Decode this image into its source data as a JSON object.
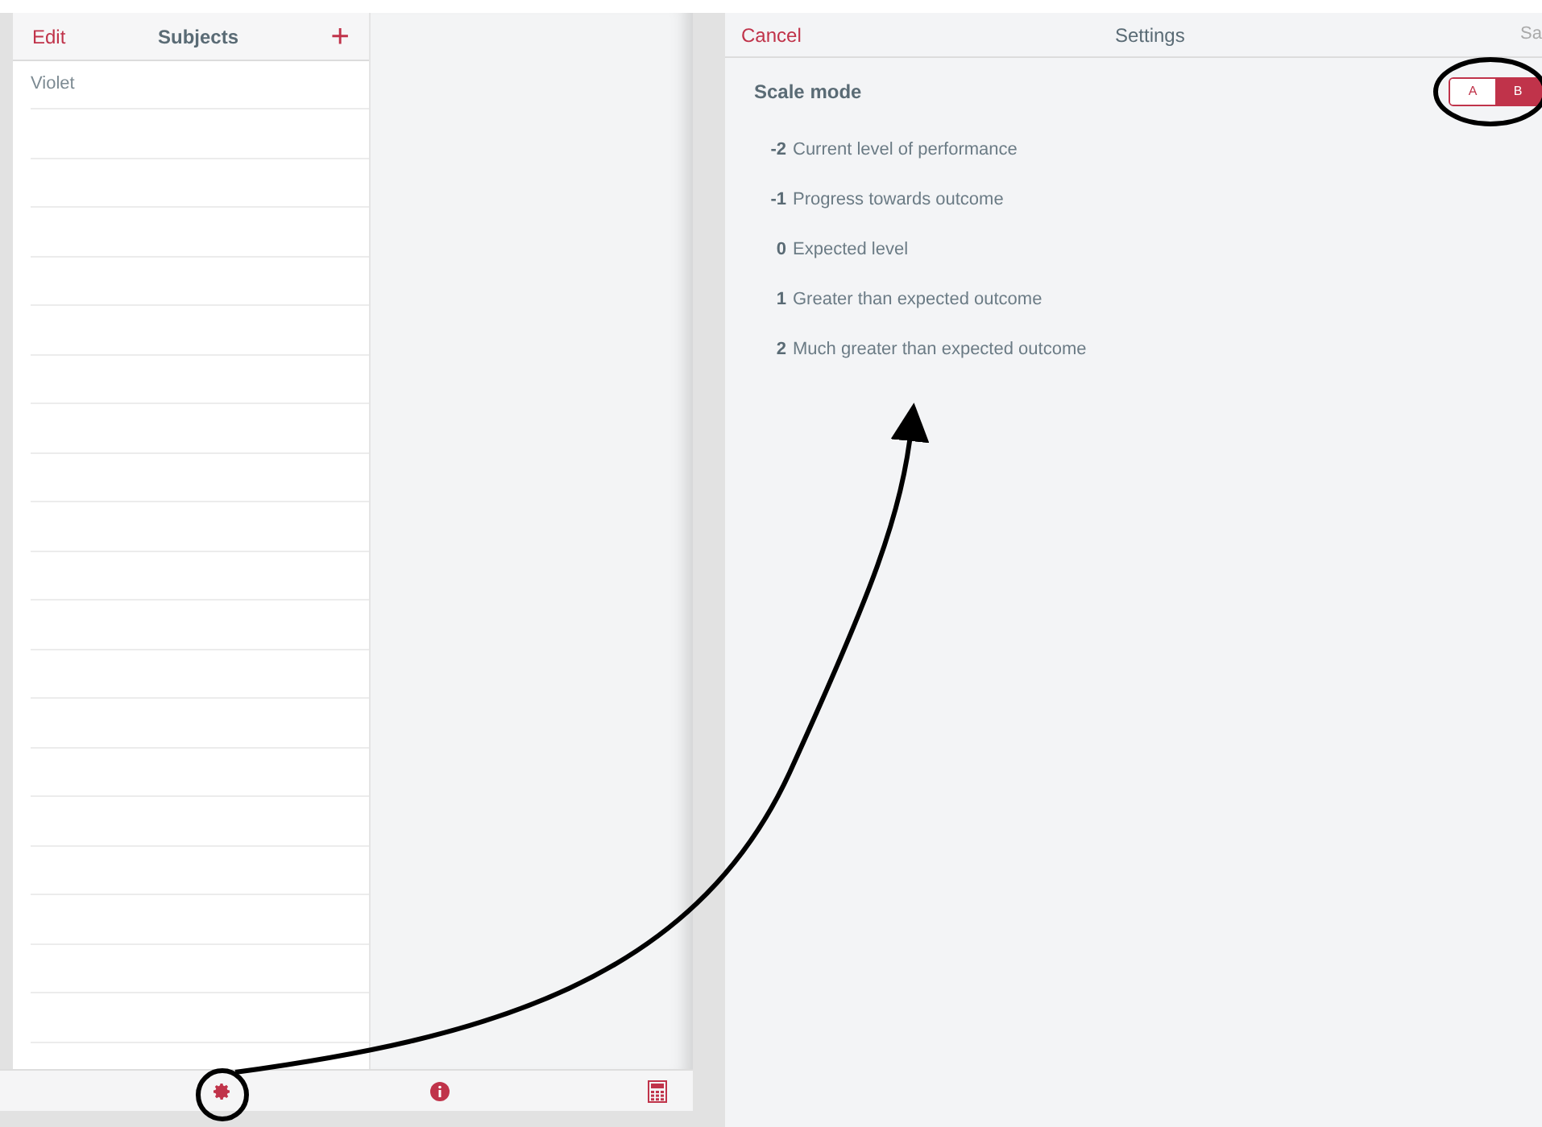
{
  "subjects_pane": {
    "edit": "Edit",
    "title": "Subjects",
    "add": "+",
    "items": [
      {
        "label": "Violet"
      }
    ]
  },
  "toolbar": {
    "buttons": [
      {
        "kind": "settings"
      },
      {
        "kind": "info"
      },
      {
        "kind": "calculator"
      }
    ]
  },
  "settings": {
    "cancel": "Cancel",
    "title": "Settings",
    "save": "Sa",
    "scale_mode": {
      "label": "Scale mode",
      "options": [
        {
          "label": "A",
          "selected": false
        },
        {
          "label": "B",
          "selected": true
        }
      ]
    },
    "scale": [
      {
        "value": "-2",
        "label": "Current level of performance"
      },
      {
        "value": "-1",
        "label": "Progress towards outcome"
      },
      {
        "value": "0",
        "label": "Expected level"
      },
      {
        "value": "1",
        "label": "Greater than expected outcome"
      },
      {
        "value": "2",
        "label": "Much greater than expected outcome"
      }
    ]
  }
}
